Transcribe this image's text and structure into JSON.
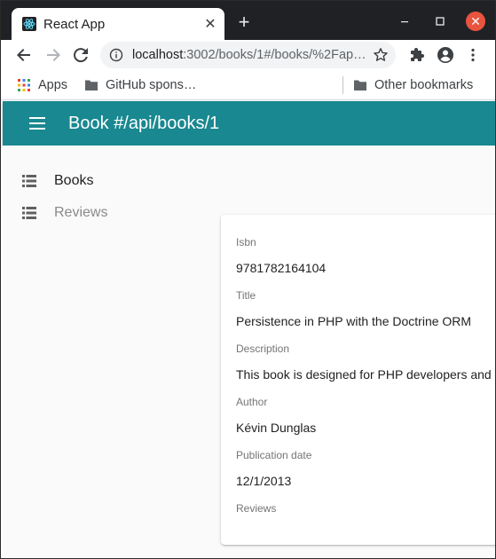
{
  "browser": {
    "tab_title": "React App",
    "url_host": "localhost",
    "url_rest": ":3002/books/1#/books/%2Fap…",
    "bookmarks": {
      "apps_label": "Apps",
      "github_label": "GitHub spons…",
      "other_label": "Other bookmarks"
    }
  },
  "app": {
    "title": "Book #/api/books/1",
    "accent_color": "#198890"
  },
  "sidebar": {
    "items": [
      {
        "label": "Books",
        "active": true
      },
      {
        "label": "Reviews",
        "active": false
      }
    ]
  },
  "book": {
    "fields": [
      {
        "label": "Isbn",
        "value": "9781782164104"
      },
      {
        "label": "Title",
        "value": "Persistence in PHP with the Doctrine ORM"
      },
      {
        "label": "Description",
        "value": "This book is designed for PHP developers and"
      },
      {
        "label": "Author",
        "value": "Kévin Dunglas"
      },
      {
        "label": "Publication date",
        "value": "12/1/2013"
      },
      {
        "label": "Reviews",
        "value": ""
      }
    ]
  }
}
